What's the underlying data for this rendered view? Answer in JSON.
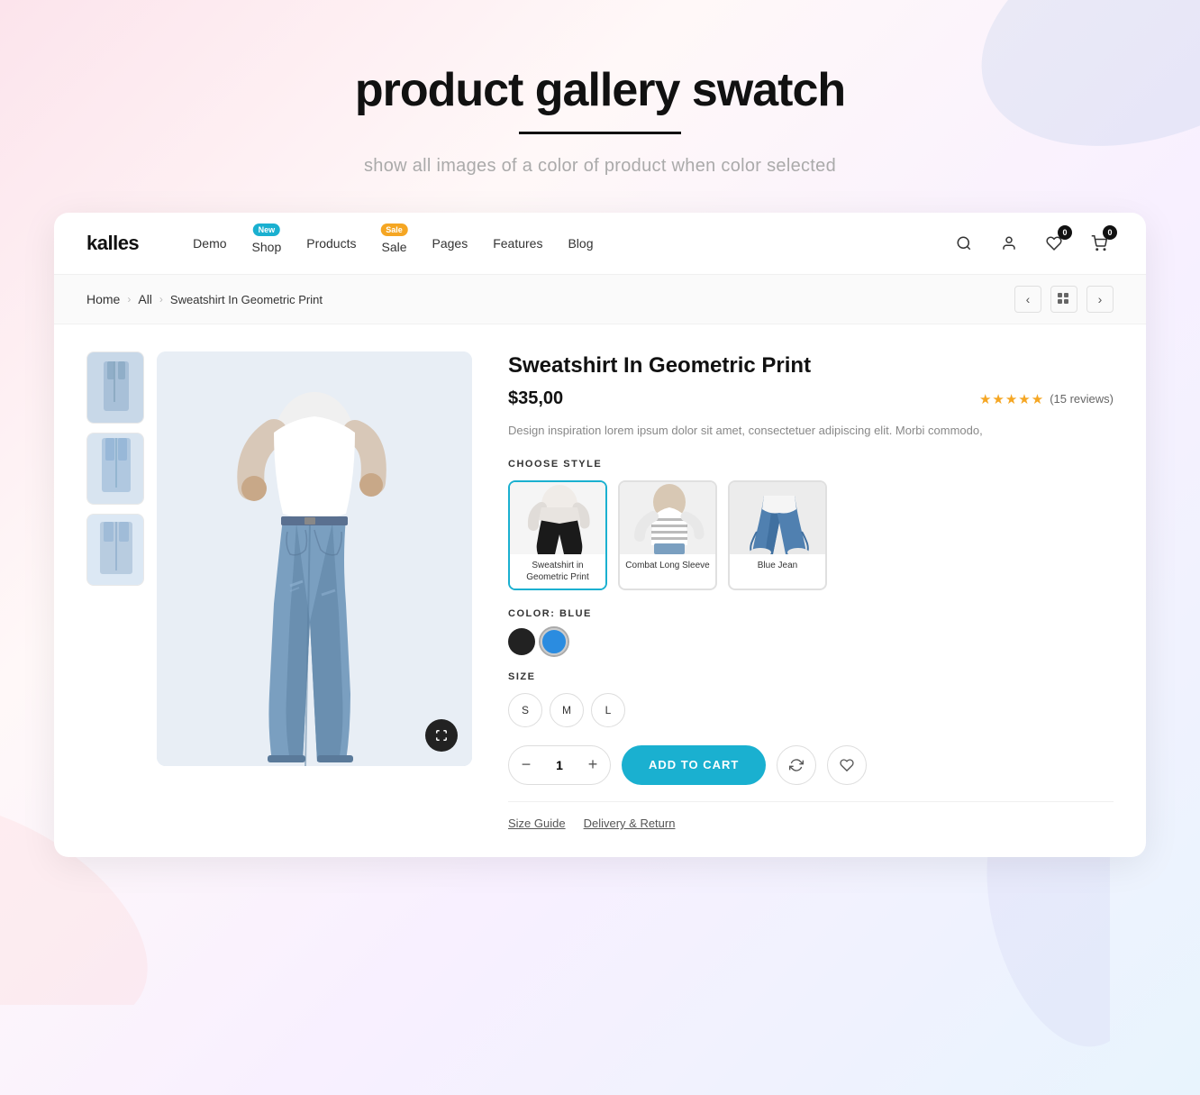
{
  "page": {
    "hero": {
      "title": "product gallery swatch",
      "subtitle": "show all images of a color of product when color selected"
    },
    "nav": {
      "logo": "kalles",
      "links": [
        {
          "label": "Demo",
          "badge": null
        },
        {
          "label": "Shop",
          "badge": {
            "text": "New",
            "type": "new"
          }
        },
        {
          "label": "Products",
          "badge": null
        },
        {
          "label": "Sale",
          "badge": {
            "text": "Sale",
            "type": "sale"
          }
        },
        {
          "label": "Pages",
          "badge": null
        },
        {
          "label": "Features",
          "badge": null
        },
        {
          "label": "Blog",
          "badge": null
        }
      ],
      "cart_count": "0",
      "wishlist_count": "0"
    },
    "breadcrumb": {
      "home": "Home",
      "all": "All",
      "current": "Sweatshirt In Geometric Print"
    },
    "product": {
      "title": "Sweatshirt In Geometric Print",
      "price": "$35,00",
      "rating_stars": "★★★★★",
      "review_count": "(15 reviews)",
      "description": "Design inspiration lorem ipsum dolor sit amet, consectetuer adipiscing elit. Morbi commodo,",
      "style_section_label": "CHOOSE STYLE",
      "styles": [
        {
          "label": "Sweatshirt in Geometric Print",
          "active": true
        },
        {
          "label": "Combat Long Sleeve",
          "active": false
        },
        {
          "label": "Blue Jean",
          "active": false
        }
      ],
      "color_label": "COLOR: BLUE",
      "color_section_label": "COLOR",
      "colors": [
        {
          "name": "black",
          "active": false
        },
        {
          "name": "blue",
          "active": true
        }
      ],
      "size_section_label": "SIZE",
      "sizes": [
        "S",
        "M",
        "L"
      ],
      "quantity": "1",
      "add_to_cart_label": "ADD TO CART",
      "footer_links": [
        {
          "label": "Size Guide"
        },
        {
          "label": "Delivery & Return"
        }
      ]
    }
  }
}
